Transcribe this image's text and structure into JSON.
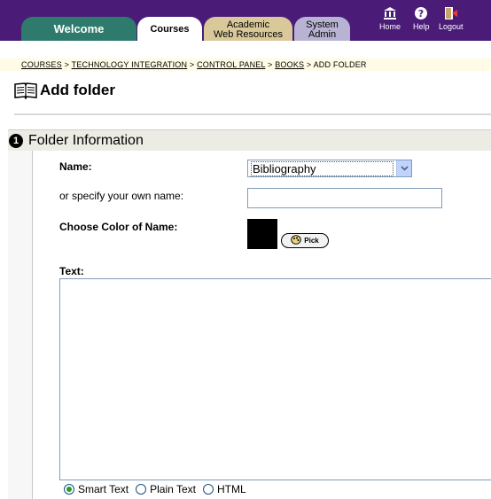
{
  "topnav": {
    "tabs": {
      "welcome": "Welcome",
      "courses": "Courses",
      "academic_line1": "Academic",
      "academic_line2": "Web Resources",
      "sysadmin_line1": "System",
      "sysadmin_line2": "Admin"
    },
    "utilities": {
      "home": "Home",
      "help": "Help",
      "logout": "Logout"
    },
    "colors": {
      "bar": "#4a1c78",
      "welcome_tab": "#2e7a6c",
      "academic_tab": "#d8c89a",
      "sysadmin_tab": "#b9b3d3"
    }
  },
  "breadcrumb": {
    "items": [
      "COURSES",
      "TECHNOLOGY INTEGRATION",
      "CONTROL PANEL",
      "BOOKS"
    ],
    "separator": " > ",
    "current": "ADD FOLDER"
  },
  "page": {
    "title": "Add folder",
    "title_icon": "book-icon"
  },
  "section": {
    "number": "1",
    "title": "Folder Information"
  },
  "form": {
    "name_label": "Name:",
    "name_selected": "Bibliography",
    "own_name_label": "or specify your own name:",
    "own_name_value": "",
    "color_label": "Choose Color of Name:",
    "color_value": "#000000",
    "pick_label": "Pick",
    "text_label": "Text:",
    "text_value": "",
    "format_options": [
      {
        "label": "Smart Text",
        "checked": true
      },
      {
        "label": "Plain Text",
        "checked": false
      },
      {
        "label": "HTML",
        "checked": false
      }
    ]
  }
}
